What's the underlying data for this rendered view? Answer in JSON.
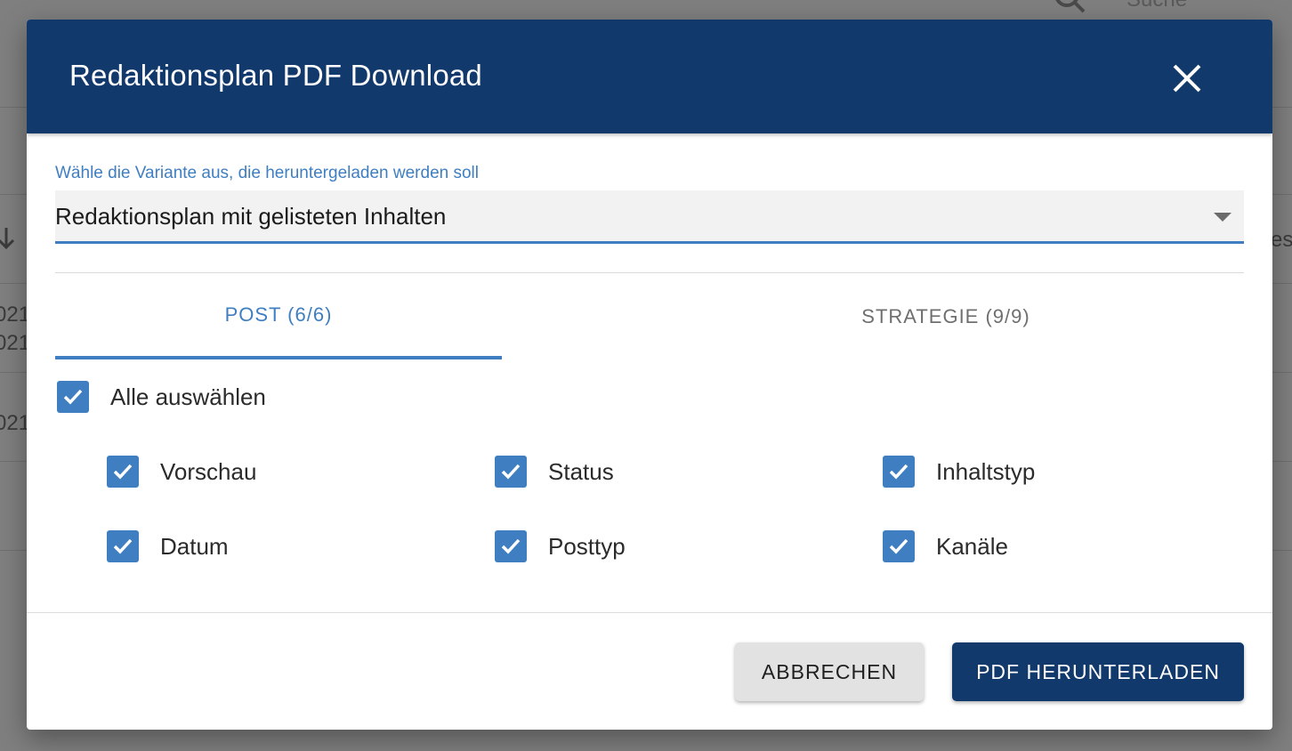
{
  "background": {
    "search_placeholder": "Suche",
    "fragments": [
      "021",
      "021",
      "021",
      "es"
    ]
  },
  "dialog": {
    "title": "Redaktionsplan PDF Download",
    "close_icon": "close-icon",
    "select": {
      "label": "Wähle die Variante aus, die heruntergeladen werden soll",
      "value": "Redaktionsplan mit gelisteten Inhalten"
    },
    "tabs": [
      {
        "label": "POST (6/6)",
        "active": true
      },
      {
        "label": "STRATEGIE (9/9)",
        "active": false
      }
    ],
    "select_all": {
      "label": "Alle auswählen",
      "checked": true
    },
    "options": [
      {
        "label": "Vorschau",
        "checked": true
      },
      {
        "label": "Status",
        "checked": true
      },
      {
        "label": "Inhaltstyp",
        "checked": true
      },
      {
        "label": "Datum",
        "checked": true
      },
      {
        "label": "Posttyp",
        "checked": true
      },
      {
        "label": "Kanäle",
        "checked": true
      }
    ],
    "buttons": {
      "cancel": "ABBRECHEN",
      "download": "PDF HERUNTERLADEN"
    }
  },
  "colors": {
    "header": "#12396c",
    "accent": "#3f7fc1",
    "cancel_bg": "#e2e2e2"
  }
}
